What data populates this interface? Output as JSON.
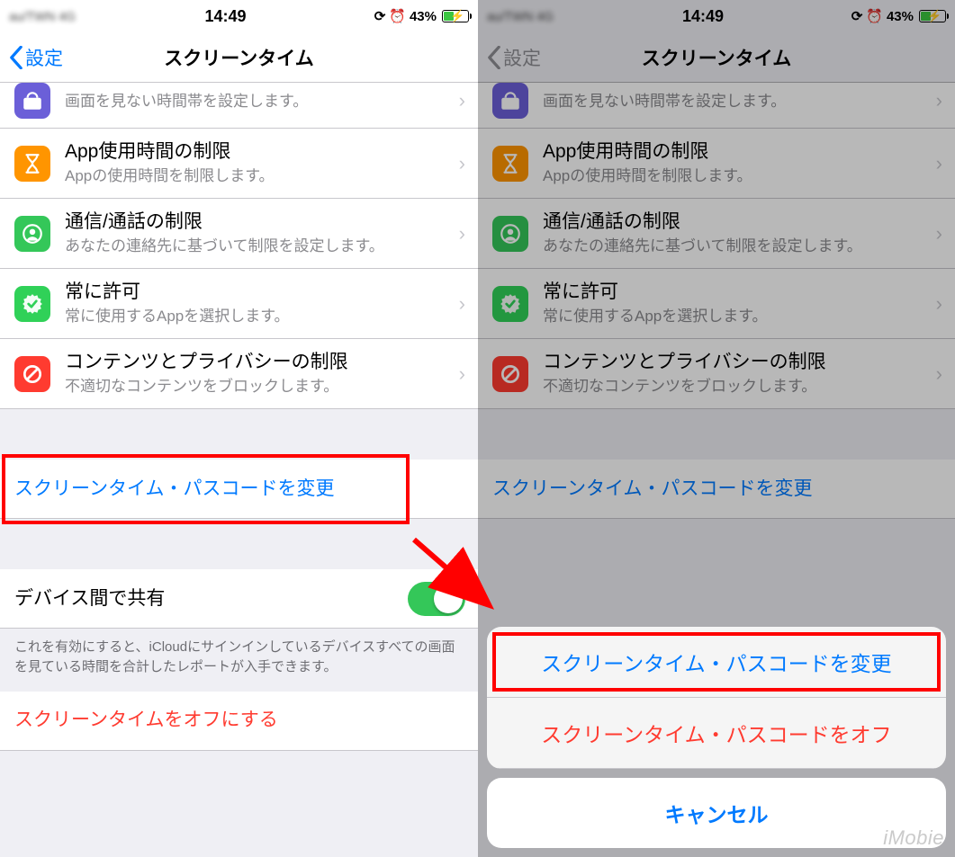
{
  "status": {
    "carrier_blur": "au/TWN 4G",
    "time": "14:49",
    "battery_pct": "43%"
  },
  "nav": {
    "back": "設定",
    "title": "スクリーンタイム"
  },
  "rows": {
    "downtime_sub": "画面を見ない時間帯を設定します。",
    "app_limit_title": "App使用時間の制限",
    "app_limit_sub": "Appの使用時間を制限します。",
    "comm_title": "通信/通話の制限",
    "comm_sub": "あなたの連絡先に基づいて制限を設定します。",
    "always_title": "常に許可",
    "always_sub": "常に使用するAppを選択します。",
    "content_title": "コンテンツとプライバシーの制限",
    "content_sub": "不適切なコンテンツをブロックします。",
    "change_passcode": "スクリーンタイム・パスコードを変更",
    "share_title": "デバイス間で共有",
    "share_note": "これを有効にすると、iCloudにサインインしているデバイスすべての画面を見ている時間を合計したレポートが入手できます。",
    "turn_off": "スクリーンタイムをオフにする"
  },
  "sheet": {
    "change": "スクリーンタイム・パスコードを変更",
    "off": "スクリーンタイム・パスコードをオフ",
    "cancel": "キャンセル"
  },
  "watermark": "iMobie"
}
